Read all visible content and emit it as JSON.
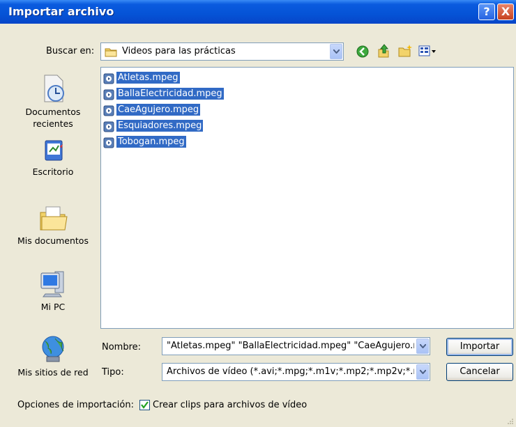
{
  "window": {
    "title": "Importar archivo",
    "help_glyph": "?",
    "close_glyph": "X"
  },
  "lookin": {
    "label": "Buscar en:",
    "value": "Videos para las prácticas"
  },
  "places": [
    {
      "label": "Documentos recientes",
      "icon": "recent-documents-icon"
    },
    {
      "label": "Escritorio",
      "icon": "desktop-icon"
    },
    {
      "label": "Mis documentos",
      "icon": "my-documents-icon"
    },
    {
      "label": "Mi PC",
      "icon": "my-computer-icon"
    },
    {
      "label": "Mis sitios de red",
      "icon": "network-places-icon"
    }
  ],
  "files": [
    {
      "name": "Atletas.mpeg",
      "selected": true
    },
    {
      "name": "BallaElectricidad.mpeg",
      "selected": true
    },
    {
      "name": "CaeAgujero.mpeg",
      "selected": true
    },
    {
      "name": "Esquiadores.mpeg",
      "selected": true
    },
    {
      "name": "Tobogan.mpeg",
      "selected": true
    }
  ],
  "filename": {
    "label": "Nombre:",
    "value": "\"Atletas.mpeg\" \"BallaElectricidad.mpeg\" \"CaeAgujero.m"
  },
  "filetype": {
    "label": "Tipo:",
    "value": "Archivos de vídeo (*.avi;*.mpg;*.m1v;*.mp2;*.mp2v;*.mpe"
  },
  "buttons": {
    "import": "Importar",
    "cancel": "Cancelar"
  },
  "options": {
    "label": "Opciones de importación:",
    "checkbox_label": "Crear clips para archivos de vídeo",
    "checked": true
  },
  "colors": {
    "title_bar": "#0553D6",
    "selection": "#316AC5",
    "dialog_bg": "#ECE9D8"
  }
}
